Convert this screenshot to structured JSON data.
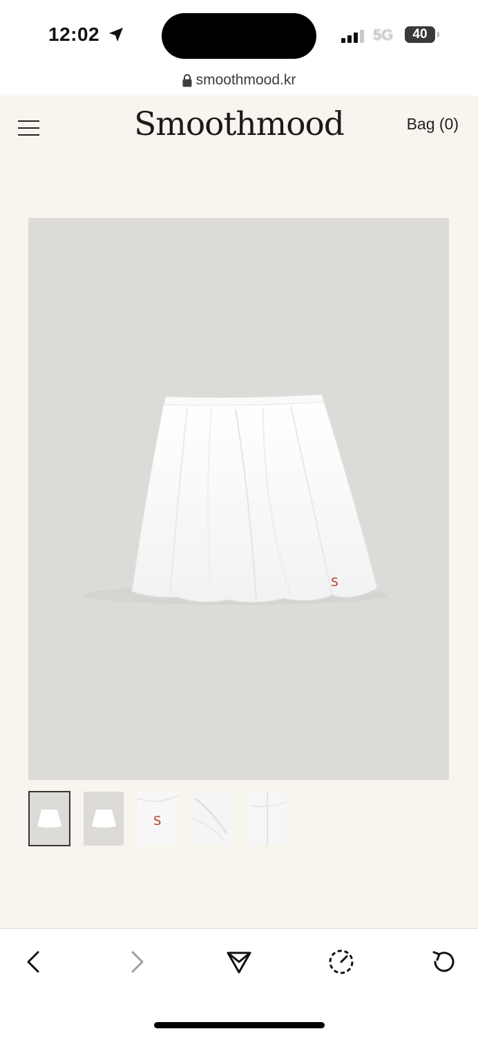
{
  "status_bar": {
    "time": "12:02",
    "network": "5G",
    "battery": "40"
  },
  "browser": {
    "url": "smoothmood.kr"
  },
  "header": {
    "logo": "Smoothmood",
    "bag_label": "Bag (0)"
  },
  "product": {
    "monogram": "S",
    "image_count": 5,
    "selected_image": 1
  },
  "toolbar": {
    "icons": [
      "back-icon",
      "forward-icon",
      "share-icon",
      "timer-icon",
      "reload-icon"
    ]
  },
  "colors": {
    "page_bg": "#f8f4ee",
    "image_bg": "#dcdbd8",
    "monogram": "#c0392b"
  }
}
